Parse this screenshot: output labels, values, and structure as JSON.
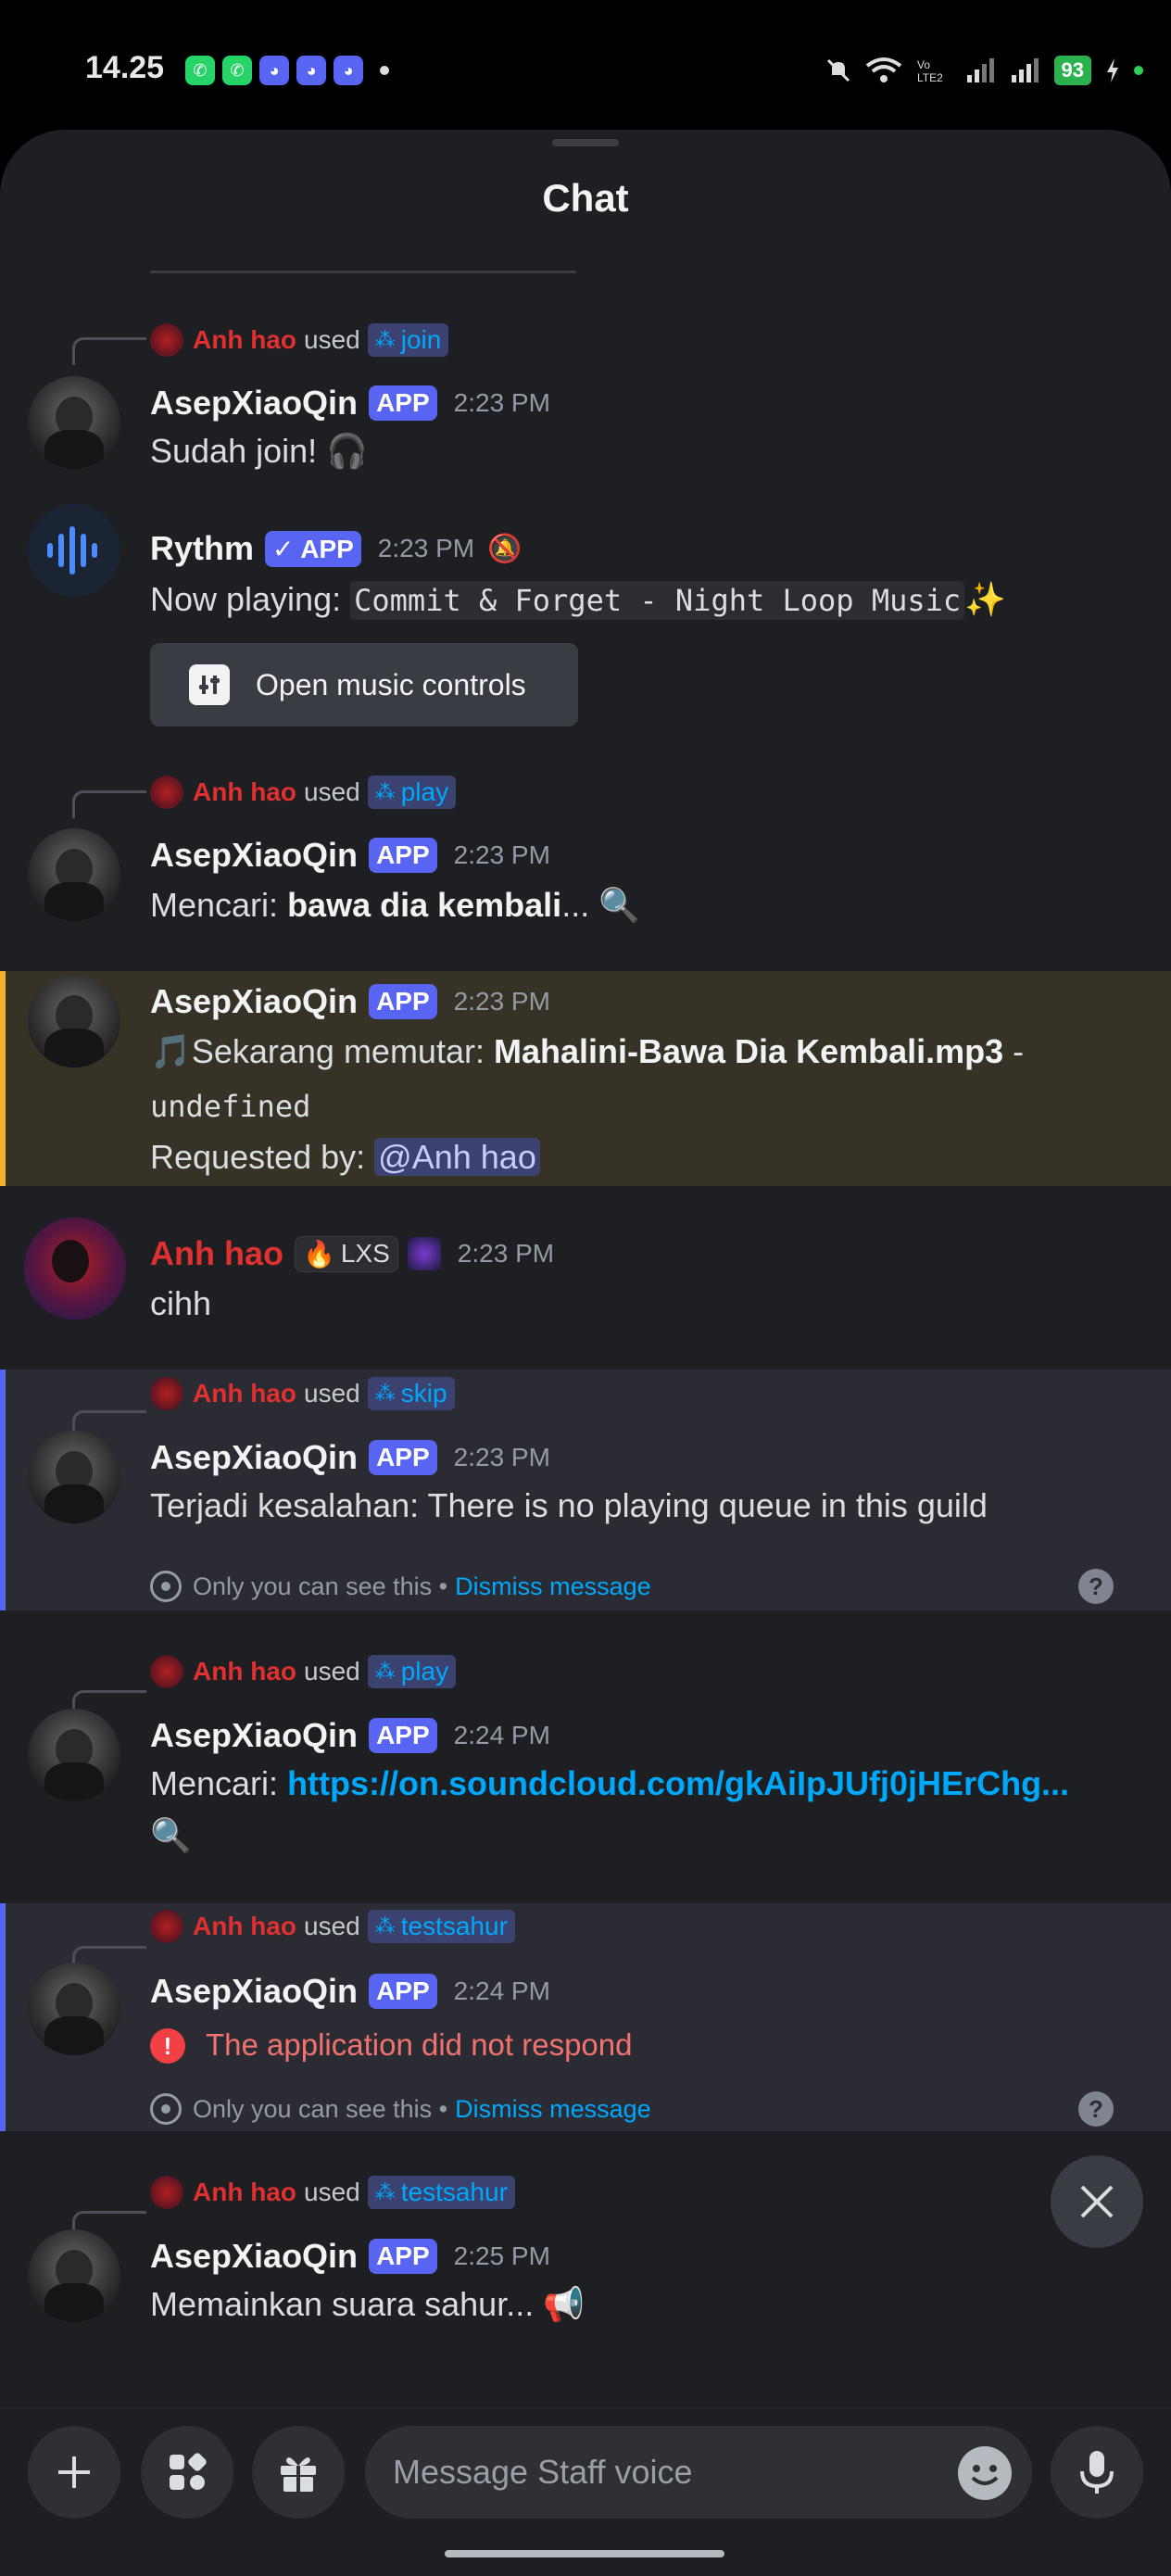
{
  "status_bar": {
    "time": "14.25",
    "apps": [
      "whatsapp-icon",
      "whatsapp-icon",
      "discord-icon",
      "discord-icon",
      "discord-icon"
    ],
    "battery": "93"
  },
  "sheet": {
    "title": "Chat"
  },
  "messages": [
    {
      "reply": {
        "name": "Anh hao",
        "used": "used",
        "command": "join"
      },
      "author": "AsepXiaoQin",
      "badge": "APP",
      "time": "2:23 PM",
      "text": "Sudah join! 🎧"
    },
    {
      "author": "Rythm",
      "badge": "✓ APP",
      "time": "2:23 PM",
      "text_prefix": "Now playing:",
      "text_code": "Commit & Forget - Night Loop Music",
      "text_suffix": "✨",
      "button": "Open music controls"
    },
    {
      "reply": {
        "name": "Anh hao",
        "used": "used",
        "command": "play"
      },
      "author": "AsepXiaoQin",
      "badge": "APP",
      "time": "2:23 PM",
      "text_prefix": "Mencari:",
      "text_bold": "bawa dia kembali",
      "text_suffix": "... 🔍"
    },
    {
      "author": "AsepXiaoQin",
      "badge": "APP",
      "time": "2:23 PM",
      "line1_icon": "🎵",
      "line1_prefix": "Sekarang memutar:",
      "line1_bold": "Mahalini-Bawa Dia Kembali.mp3",
      "line1_suffix": "-",
      "line2_code": "undefined",
      "line3_prefix": "Requested by:",
      "line3_mention": "@Anh hao"
    },
    {
      "author": "Anh hao",
      "tag": "LXS",
      "time": "2:23 PM",
      "text": "cihh"
    },
    {
      "reply": {
        "name": "Anh hao",
        "used": "used",
        "command": "skip"
      },
      "author": "AsepXiaoQin",
      "badge": "APP",
      "time": "2:23 PM",
      "text": "Terjadi kesalahan: There is no playing queue in this guild",
      "ephemeral": "Only you can see this •",
      "dismiss": "Dismiss message"
    },
    {
      "reply": {
        "name": "Anh hao",
        "used": "used",
        "command": "play"
      },
      "author": "AsepXiaoQin",
      "badge": "APP",
      "time": "2:24 PM",
      "text_prefix": "Mencari:",
      "link": "https://on.soundcloud.com/gkAiIpJUfj0jHErChg...",
      "text_suffix": "🔍"
    },
    {
      "reply": {
        "name": "Anh hao",
        "used": "used",
        "command": "testsahur"
      },
      "author": "AsepXiaoQin",
      "badge": "APP",
      "time": "2:24 PM",
      "error": "The application did not respond",
      "ephemeral": "Only you can see this •",
      "dismiss": "Dismiss message"
    },
    {
      "reply": {
        "name": "Anh hao",
        "used": "used",
        "command": "testsahur"
      },
      "author": "AsepXiaoQin",
      "badge": "APP",
      "time": "2:25 PM",
      "text": "Memainkan suara sahur... 📢"
    }
  ],
  "composer": {
    "placeholder": "Message Staff voice"
  },
  "colors": {
    "background": "#1e1f22",
    "accent": "#5865f2",
    "link": "#00a8fc",
    "username_red": "#e0302f",
    "highlight": "#373226",
    "ephemeral_bg": "#2b2c33"
  }
}
